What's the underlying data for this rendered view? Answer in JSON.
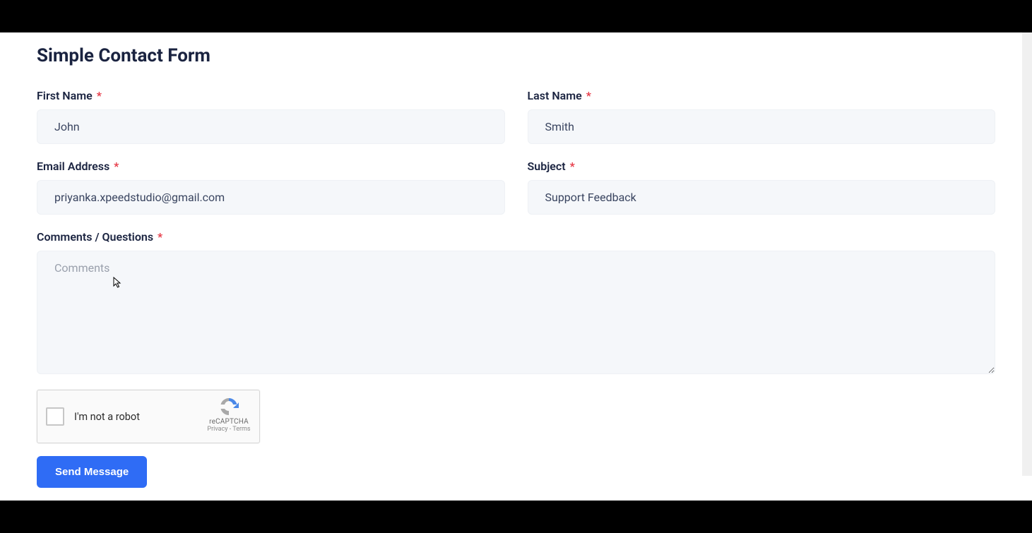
{
  "form": {
    "title": "Simple Contact Form",
    "first_name": {
      "label": "First Name",
      "value": "John"
    },
    "last_name": {
      "label": "Last Name",
      "value": "Smith"
    },
    "email": {
      "label": "Email Address",
      "value": "priyanka.xpeedstudio@gmail.com"
    },
    "subject": {
      "label": "Subject",
      "value": "Support Feedback"
    },
    "comments": {
      "label": "Comments / Questions",
      "placeholder": "Comments",
      "value": ""
    },
    "required_mark": "*",
    "captcha": {
      "label": "I'm not a robot",
      "brand": "reCAPTCHA",
      "links": "Privacy - Terms"
    },
    "submit_label": "Send Message"
  }
}
